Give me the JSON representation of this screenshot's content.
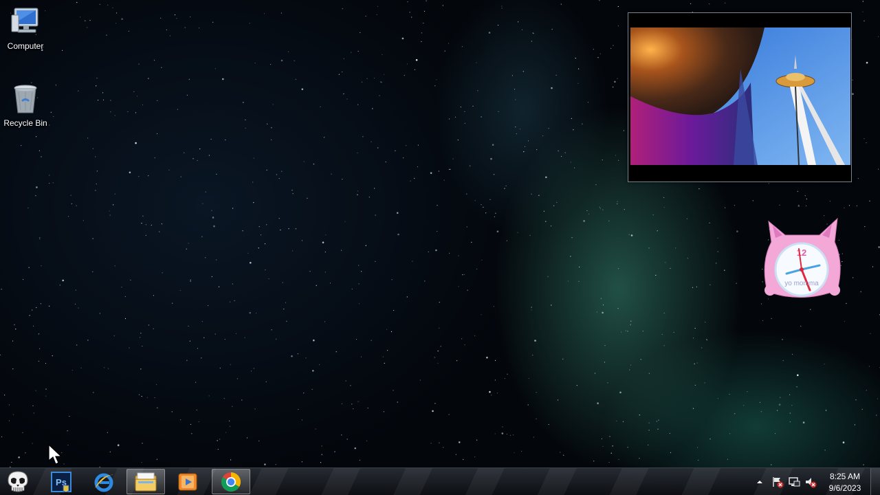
{
  "desktop": {
    "icons": [
      {
        "label": "Computer",
        "icon": "computer-icon"
      },
      {
        "label": "Recycle Bin",
        "icon": "recycle-bin-icon"
      }
    ]
  },
  "gadgets": {
    "slideshow": {
      "subject": "photo-slideshow"
    },
    "clock": {
      "label": "yo momma",
      "numeral_12": "12"
    }
  },
  "taskbar": {
    "start_icon": "skull-start-icon",
    "pinned": [
      {
        "name": "Photoshop",
        "icon": "photoshop-icon",
        "text": "Ps"
      },
      {
        "name": "Internet Explorer",
        "icon": "internet-explorer-icon"
      },
      {
        "name": "Windows Explorer",
        "icon": "file-explorer-icon"
      },
      {
        "name": "Windows Media Player",
        "icon": "media-player-icon"
      },
      {
        "name": "Google Chrome",
        "icon": "chrome-icon",
        "active": true
      }
    ],
    "tray": {
      "icons": [
        "show-hidden-icons-arrow",
        "action-center-flag-icon",
        "network-icon",
        "volume-muted-icon"
      ],
      "time": "8:25 AM",
      "date": "9/6/2023"
    }
  },
  "colors": {
    "taskbar": "#1a1d23",
    "nebula": "#46aa8c",
    "sky": "#03060b"
  }
}
